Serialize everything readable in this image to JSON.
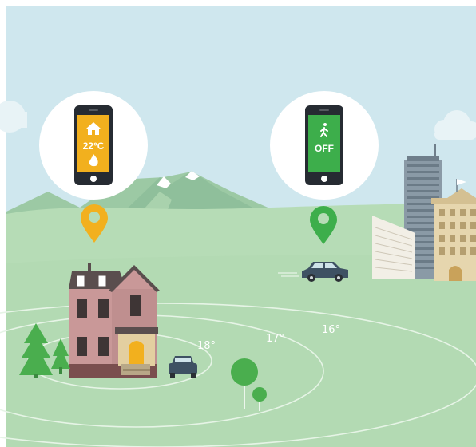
{
  "phone_heating": {
    "temperature_text": "22°C",
    "screen_color": "#f2b01e",
    "icons": [
      "home-icon",
      "flame-icon"
    ]
  },
  "phone_away": {
    "status_text": "OFF",
    "screen_color": "#3dae4b",
    "icons": [
      "walking-person-icon"
    ]
  },
  "distance_rings": {
    "labels": [
      "18°",
      "17°",
      "16°"
    ]
  },
  "colors": {
    "sky": "#cfe7ee",
    "ground": "#b6dcb6",
    "hills": "#a8d1a5",
    "pin_home": "#f2b01e",
    "pin_away": "#3dae4b",
    "car": "#3e5163",
    "house_wall": "#c99898",
    "house_roof": "#5a4e4e",
    "tree": "#4aae4e"
  }
}
